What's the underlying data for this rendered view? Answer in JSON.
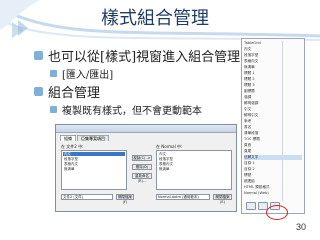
{
  "slide": {
    "title": "樣式組合管理",
    "bullets": [
      {
        "text": "也可以從[樣式]視窗進入組合管理"
      },
      {
        "text": "[匯入/匯出]"
      },
      {
        "text": "組合管理"
      },
      {
        "text": "複製既有樣式，但不會更動範本"
      }
    ],
    "page_number": "30"
  },
  "dialog": {
    "tabs": [
      "組織",
      "巨集專案項目"
    ],
    "left_label": "在 文件2 中:",
    "right_label": "在 Normal 中:",
    "left_items": [
      "內文",
      "段落字型",
      "表格內文",
      "無清單"
    ],
    "right_items": [
      "內文",
      "段落字型",
      "表格內文",
      "無清單"
    ],
    "left_combo": "文件2 (文件)",
    "right_combo": "Normal.dotm (通用範本)",
    "buttons": [
      "複製(C) ->",
      "刪除(D)",
      "重新命名(R)..."
    ],
    "close_buttons": [
      "關閉檔案(F)",
      "關閉檔案(E)"
    ]
  },
  "style_panel": {
    "rows": [
      "TableGrid",
      "內文",
      "段落字型",
      "表格內文",
      "無清單",
      "標題 1",
      "標題 2",
      "標題 3",
      "副標題",
      "強調",
      "鮮明強調",
      "引文",
      "鮮明引文",
      "參考",
      "書名",
      "清單段落",
      "TOC 標題",
      "頁首",
      "頁尾",
      "註解文字",
      "目錄 1",
      "目錄 2",
      "標號",
      "超連結",
      "HTML 預設格式",
      "Normal (Web)"
    ]
  }
}
